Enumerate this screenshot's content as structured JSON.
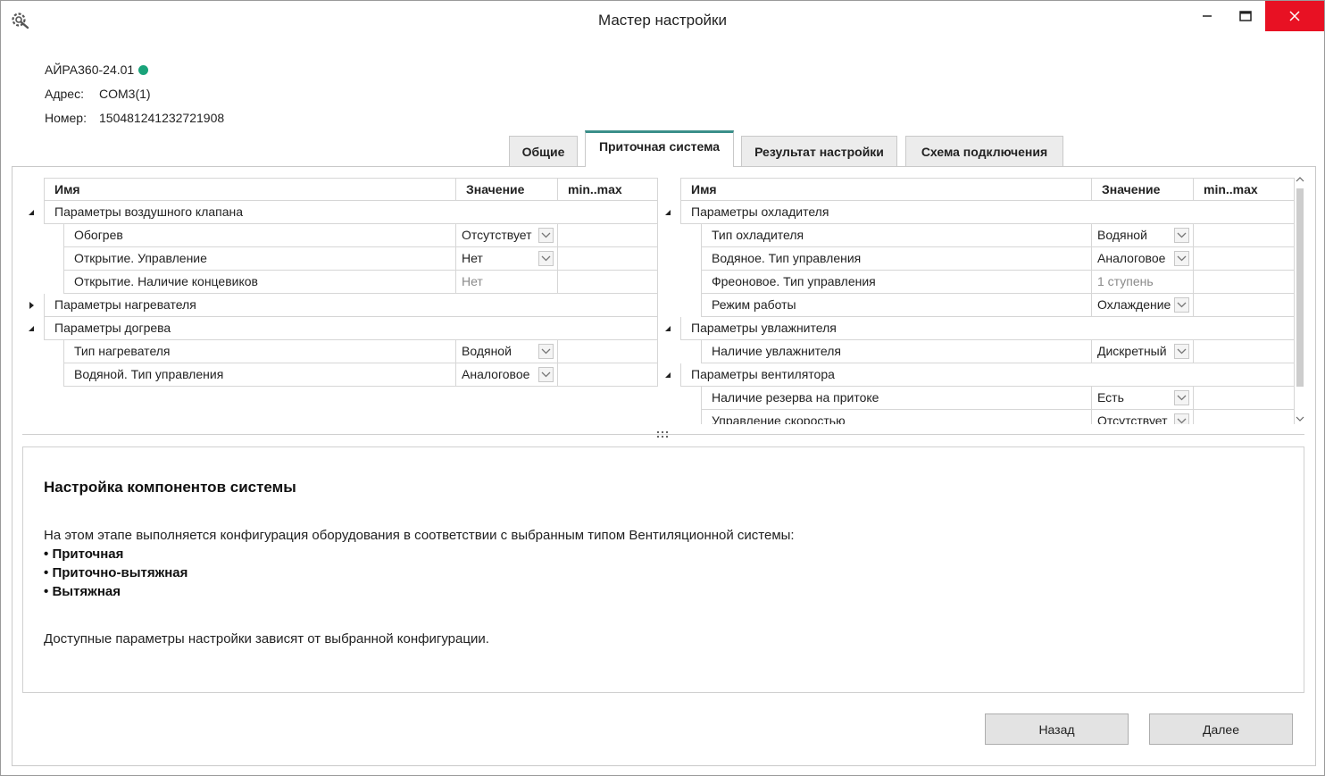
{
  "window": {
    "title": "Мастер настройки"
  },
  "device": {
    "name": "АЙРА360-24.01",
    "status_color": "#1aa37a",
    "address_label": "Адрес:",
    "address_value": "COM3(1)",
    "number_label": "Номер:",
    "number_value": "150481241232721908"
  },
  "tabs": [
    {
      "label": "Общие"
    },
    {
      "label": "Приточная система"
    },
    {
      "label": "Результат настройки"
    },
    {
      "label": "Схема подключения"
    }
  ],
  "grid_headers": {
    "name": "Имя",
    "value": "Значение",
    "range": "min..max"
  },
  "left_grid": {
    "rows": [
      {
        "type": "group",
        "label": "Параметры воздушного клапана",
        "expanded": true
      },
      {
        "type": "item",
        "label": "Обогрев",
        "value": "Отсутствует",
        "dropdown": true
      },
      {
        "type": "item",
        "label": "Открытие. Управление",
        "value": "Нет",
        "dropdown": true
      },
      {
        "type": "item",
        "label": "Открытие. Наличие концевиков",
        "value": "Нет",
        "dropdown": false,
        "disabled": true
      },
      {
        "type": "group",
        "label": "Параметры нагревателя",
        "expanded": false
      },
      {
        "type": "group",
        "label": "Параметры догрева",
        "expanded": true
      },
      {
        "type": "item",
        "label": "Тип нагревателя",
        "value": "Водяной",
        "dropdown": true
      },
      {
        "type": "item",
        "label": "Водяной. Тип управления",
        "value": "Аналоговое",
        "dropdown": true
      }
    ]
  },
  "right_grid": {
    "rows": [
      {
        "type": "group",
        "label": "Параметры охладителя",
        "expanded": true
      },
      {
        "type": "item",
        "label": "Тип охладителя",
        "value": "Водяной",
        "dropdown": true
      },
      {
        "type": "item",
        "label": "Водяное. Тип управления",
        "value": "Аналоговое",
        "dropdown": true
      },
      {
        "type": "item",
        "label": "Фреоновое. Тип управления",
        "value": "1 ступень",
        "dropdown": false,
        "disabled": true
      },
      {
        "type": "item",
        "label": "Режим работы",
        "value": "Охлаждение",
        "dropdown": true
      },
      {
        "type": "group",
        "label": "Параметры увлажнителя",
        "expanded": true
      },
      {
        "type": "item",
        "label": "Наличие увлажнителя",
        "value": "Дискретный",
        "dropdown": true
      },
      {
        "type": "group",
        "label": "Параметры вентилятора",
        "expanded": true
      },
      {
        "type": "item",
        "label": "Наличие резерва на притоке",
        "value": "Есть",
        "dropdown": true
      },
      {
        "type": "item",
        "label": "Управление скоростью",
        "value": "Отсутствует",
        "dropdown": true
      }
    ]
  },
  "description": {
    "heading": "Настройка компонентов системы",
    "intro": "На этом этапе выполняется конфигурация оборудования в соответствии с выбранным типом Вентиляционной системы:",
    "bullets": [
      "Приточная",
      "Приточно-вытяжная",
      "Вытяжная"
    ],
    "bullet_char": "•",
    "footer": "Доступные параметры настройки зависят от выбранной конфигурации."
  },
  "buttons": {
    "back": "Назад",
    "next": "Далее"
  }
}
